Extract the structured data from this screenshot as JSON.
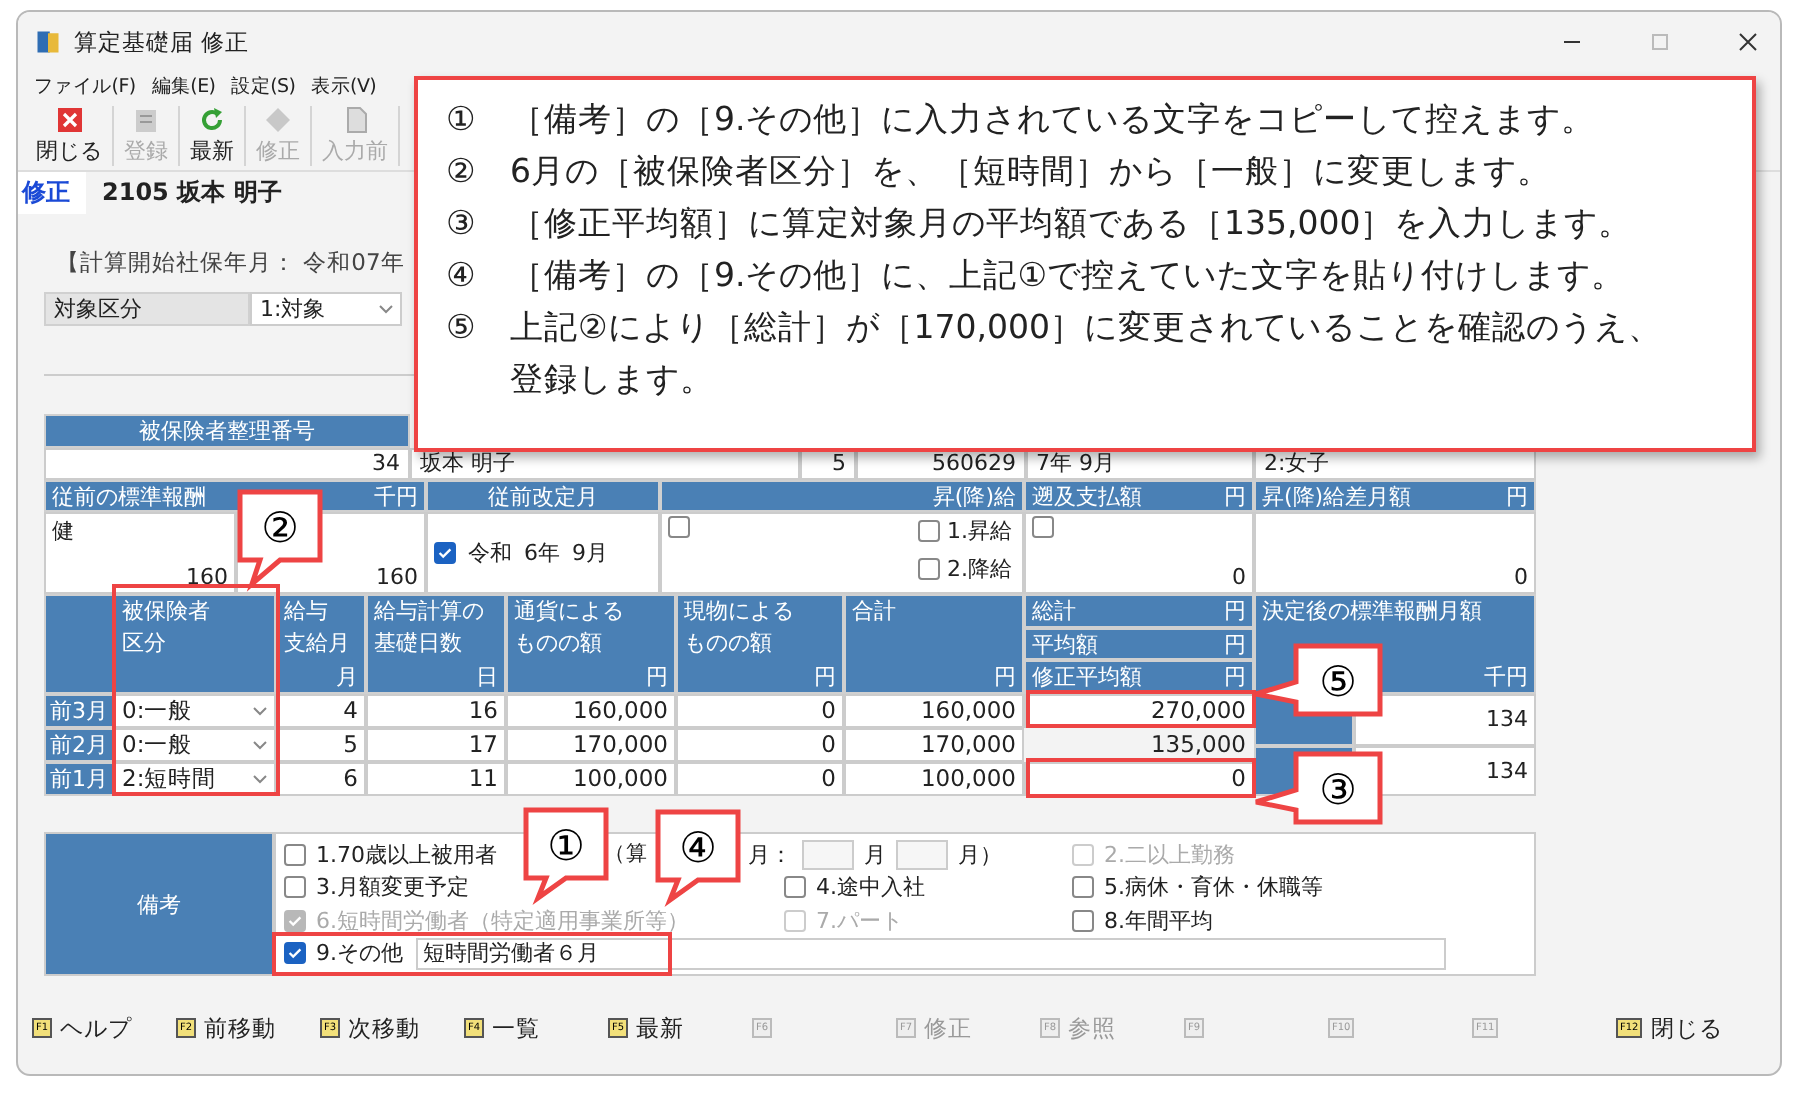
{
  "window": {
    "title": "算定基礎届 修正"
  },
  "menu": [
    "ファイル(F)",
    "編集(E)",
    "設定(S)",
    "表示(V)"
  ],
  "toolbar": [
    {
      "label": "閉じる",
      "disabled": false
    },
    {
      "label": "登録",
      "disabled": true
    },
    {
      "label": "最新",
      "disabled": false
    },
    {
      "label": "修正",
      "disabled": true
    },
    {
      "label": "入力前",
      "disabled": true
    }
  ],
  "header": {
    "mode": "修正",
    "employee": "2105 坂本 明子"
  },
  "period_label": "【計算開始社保年月： 令和07年",
  "target": {
    "label": "対象区分",
    "value": "1:対象"
  },
  "insured": {
    "header": "被保険者整理番号",
    "cells": [
      "34",
      "坂本 明子",
      "5",
      "560629",
      "7年 9月"
    ],
    "gender": "2:女子"
  },
  "previous": {
    "header": "従前の標準報酬",
    "unit": "千円",
    "health_label": "健",
    "health": "160",
    "pension": "160"
  },
  "revision": {
    "header": "従前改定月",
    "checked": true,
    "era": "令和",
    "year": "6年",
    "month": "9月"
  },
  "raise": {
    "header": "昇(降)給",
    "checked": false,
    "options": [
      {
        "label": "1.昇給",
        "checked": false
      },
      {
        "label": "2.降給",
        "checked": false
      }
    ]
  },
  "retro": {
    "header": "遡及支払額",
    "unit": "円",
    "checked": false,
    "value": "0"
  },
  "difference": {
    "header": "昇(降)給差月額",
    "unit": "円",
    "value": "0"
  },
  "columns": [
    {
      "title_lines": [
        "被保険者",
        "区分"
      ]
    },
    {
      "title_lines": [
        "給与",
        "支給月"
      ],
      "unit": "月"
    },
    {
      "title_lines": [
        "給与計算の",
        "基礎日数"
      ],
      "unit": "日"
    },
    {
      "title_lines": [
        "通貨による",
        "ものの額"
      ],
      "unit": "円"
    },
    {
      "title_lines": [
        "現物による",
        "ものの額"
      ],
      "unit": "円"
    },
    {
      "title_lines": [
        "合計"
      ],
      "unit": "円"
    }
  ],
  "total_headers": [
    {
      "title": "総計",
      "unit": "円"
    },
    {
      "title": "平均額",
      "unit": "円"
    },
    {
      "title": "修正平均額",
      "unit": "円"
    }
  ],
  "final_header": {
    "title": "決定後の標準報酬月額",
    "unit": "千円"
  },
  "rows": [
    {
      "month": "前3月",
      "category": "0:一般",
      "paid_month": "4",
      "days": "16",
      "cash": "160,000",
      "goods": "0",
      "total": "160,000",
      "summary": "270,000"
    },
    {
      "month": "前2月",
      "category": "0:一般",
      "paid_month": "5",
      "days": "17",
      "cash": "170,000",
      "goods": "0",
      "total": "170,000",
      "summary": "135,000"
    },
    {
      "month": "前1月",
      "category": "2:短時間",
      "paid_month": "6",
      "days": "11",
      "cash": "100,000",
      "goods": "0",
      "total": "100,000",
      "summary": "0"
    }
  ],
  "final_values": [
    "134",
    "134"
  ],
  "remarks": {
    "label": "備考",
    "options": [
      {
        "label": "1.70歳以上被用者",
        "checked": false,
        "disabled": false
      },
      {
        "label": "2.二以上勤務",
        "checked": false,
        "disabled": true
      },
      {
        "label": "3.月額変更予定",
        "checked": false,
        "disabled": false
      },
      {
        "label": "4.途中入社",
        "checked": false,
        "disabled": false
      },
      {
        "label": "5.病休・育休・休職等",
        "checked": false,
        "disabled": false
      },
      {
        "label": "6.短時間労働者（特定適用事業所等）",
        "checked": true,
        "disabled": true
      },
      {
        "label": "7.パート",
        "checked": false,
        "disabled": true
      },
      {
        "label": "8.年間平均",
        "checked": false,
        "disabled": false
      },
      {
        "label": "9.その他",
        "checked": true,
        "disabled": false
      }
    ],
    "base_month_parts": [
      "（算",
      "月："
    ],
    "month_unit": "月",
    "month_unit_close": "月）",
    "other_text": "短時間労働者６月"
  },
  "function_keys": [
    {
      "key": "F1",
      "label": "ヘルプ",
      "disabled": false
    },
    {
      "key": "F2",
      "label": "前移動",
      "disabled": false
    },
    {
      "key": "F3",
      "label": "次移動",
      "disabled": false
    },
    {
      "key": "F4",
      "label": "一覧",
      "disabled": false
    },
    {
      "key": "F5",
      "label": "最新",
      "disabled": false
    },
    {
      "key": "F6",
      "disabled": true
    },
    {
      "key": "F7",
      "label": "修正",
      "disabled": true
    },
    {
      "key": "F8",
      "label": "参照",
      "disabled": true
    },
    {
      "key": "F9",
      "disabled": true
    },
    {
      "key": "F10",
      "disabled": true
    },
    {
      "key": "F11",
      "disabled": true
    },
    {
      "key": "F12",
      "label": "閉じる",
      "disabled": false
    }
  ],
  "instructions": [
    {
      "number": "①",
      "text": "［備考］の［9.その他］に入力されている文字をコピーして控えます。"
    },
    {
      "number": "②",
      "text": "6月の［被保険者区分］を、［短時間］から［一般］に変更します。"
    },
    {
      "number": "③",
      "text": "［修正平均額］に算定対象月の平均額である［135,000］を入力します。"
    },
    {
      "number": "④",
      "text": "［備考］の［9.その他］に、上記①で控えていた文字を貼り付けします。"
    },
    {
      "number": "⑤",
      "text": "上記②により［総計］が［170,000］に変更されていることを確認のうえ、登録します。"
    }
  ],
  "callouts": [
    "②",
    "⑤",
    "③",
    "①",
    "④"
  ]
}
